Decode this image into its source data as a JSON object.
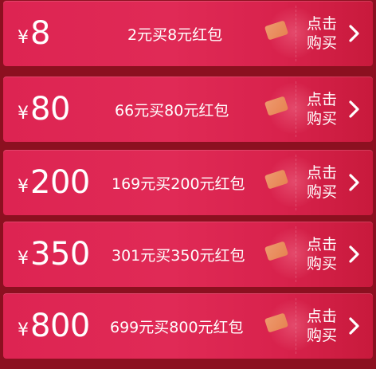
{
  "packages": [
    {
      "currency": "¥",
      "amount": "8",
      "description": "2元买8元红包",
      "action": "点击购买"
    },
    {
      "currency": "¥",
      "amount": "80",
      "description": "66元买80元红包",
      "action": "点击购买"
    },
    {
      "currency": "¥",
      "amount": "200",
      "description": "169元买200元红包",
      "action": "点击购买"
    },
    {
      "currency": "¥",
      "amount": "350",
      "description": "301元买350元红包",
      "action": "点击购买"
    },
    {
      "currency": "¥",
      "amount": "800",
      "description": "699元买800元红包",
      "action": "点击购买"
    }
  ],
  "icons": {
    "buy": "chevron-right-icon",
    "decoration": "red-envelope-icon"
  },
  "colors": {
    "card": "#e02a56",
    "background": "#8c1020",
    "text": "#ffffff"
  }
}
